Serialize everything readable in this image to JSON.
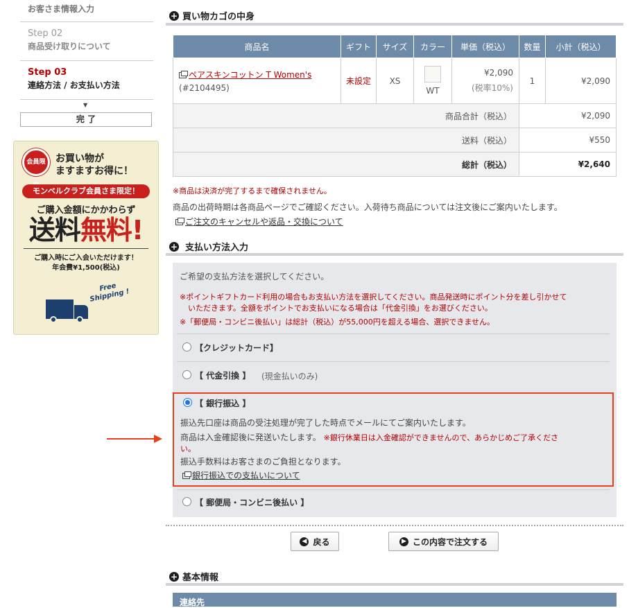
{
  "sidebar": {
    "step_prev_label": "お客さま情報入力",
    "step02": {
      "num": "Step 02",
      "label": "商品受け取りについて"
    },
    "step03": {
      "num": "Step 03",
      "label": "連絡方法 / お支払い方法"
    },
    "arrow": "▼",
    "done": "完 了"
  },
  "banner": {
    "badge": "会員限定",
    "headline1": "お買い物が",
    "headline2": "ますますお得に！",
    "ribbon": "モンベルクラブ会員さま限定！",
    "line1": "ご購入金額にかかわらず",
    "big1": "送料",
    "big2": "無料!",
    "sub1": "ご購入時にご入会いただけます！",
    "sub2": "年会費¥1,500(税込)",
    "free": "Free",
    "shipping": "Shipping !"
  },
  "cart": {
    "title": "買い物カゴの中身",
    "headers": [
      "商品名",
      "ギフト",
      "サイズ",
      "カラー",
      "単価（税込）",
      "数量",
      "小計（税込）"
    ],
    "item": {
      "name": "ペアスキンコットン T Women's",
      "code": "(#2104495)",
      "gift": "未設定",
      "size": "XS",
      "color": "WT",
      "price": "¥2,090",
      "tax_rate": "(税率10%)",
      "qty": "1",
      "subtotal": "¥2,090"
    },
    "goods_total_label": "商品合計（税込）",
    "goods_total": "¥2,090",
    "shipping_label": "送料（税込）",
    "shipping": "¥550",
    "grand_label": "総計（税込）",
    "grand": "¥2,640",
    "note_red": "※商品は決済が完了するまで確保されません。",
    "note": "商品の出荷時期は各商品ページでご確認ください。入荷待ち商品については注文後にご案内いたします。",
    "cancel_link": "ご注文のキャンセルや返品・交換について"
  },
  "payment": {
    "title": "支払い方法入力",
    "intro": "ご希望の支払方法を選択してください。",
    "note1a": "※ポイントギフトカード利用の場合もお支払い方法を選択してください。商品発送時にポイント分を差し引かせて",
    "note1b": "いただきます。全額をポイントでお支払いになる場合は「代金引換」をお選びください。",
    "note2": "※「郵便局・コンビニ後払い」は総計（税込）が55,000円を超える場合、選択できません。",
    "opt_credit": "【クレジットカード】",
    "opt_cod": "【 代金引換 】",
    "opt_cod_note": "(現金払いのみ)",
    "opt_bank": "【 銀行振込 】",
    "bank_desc1": "振込先口座は商品の受注処理が完了した時点でメールにてご案内いたします。",
    "bank_desc2a": "商品は入金確認後に発送いたします。",
    "bank_desc2b": "※銀行休業日は入金確認ができませんので、あらかじめご了承くださ",
    "bank_desc2c": "い。",
    "bank_desc3": "振込手数料はお客さまのご負担となります。",
    "bank_link": "銀行振込での支払いについて",
    "opt_post": "【 郵便局・コンビニ後払い 】"
  },
  "buttons": {
    "back": "戻る",
    "order": "この内容で注文する"
  },
  "basic": {
    "title": "基本情報",
    "table_header": "連絡先"
  },
  "colors": {
    "accent_red": "#e8401c",
    "table_header": "#6d8aa8"
  }
}
